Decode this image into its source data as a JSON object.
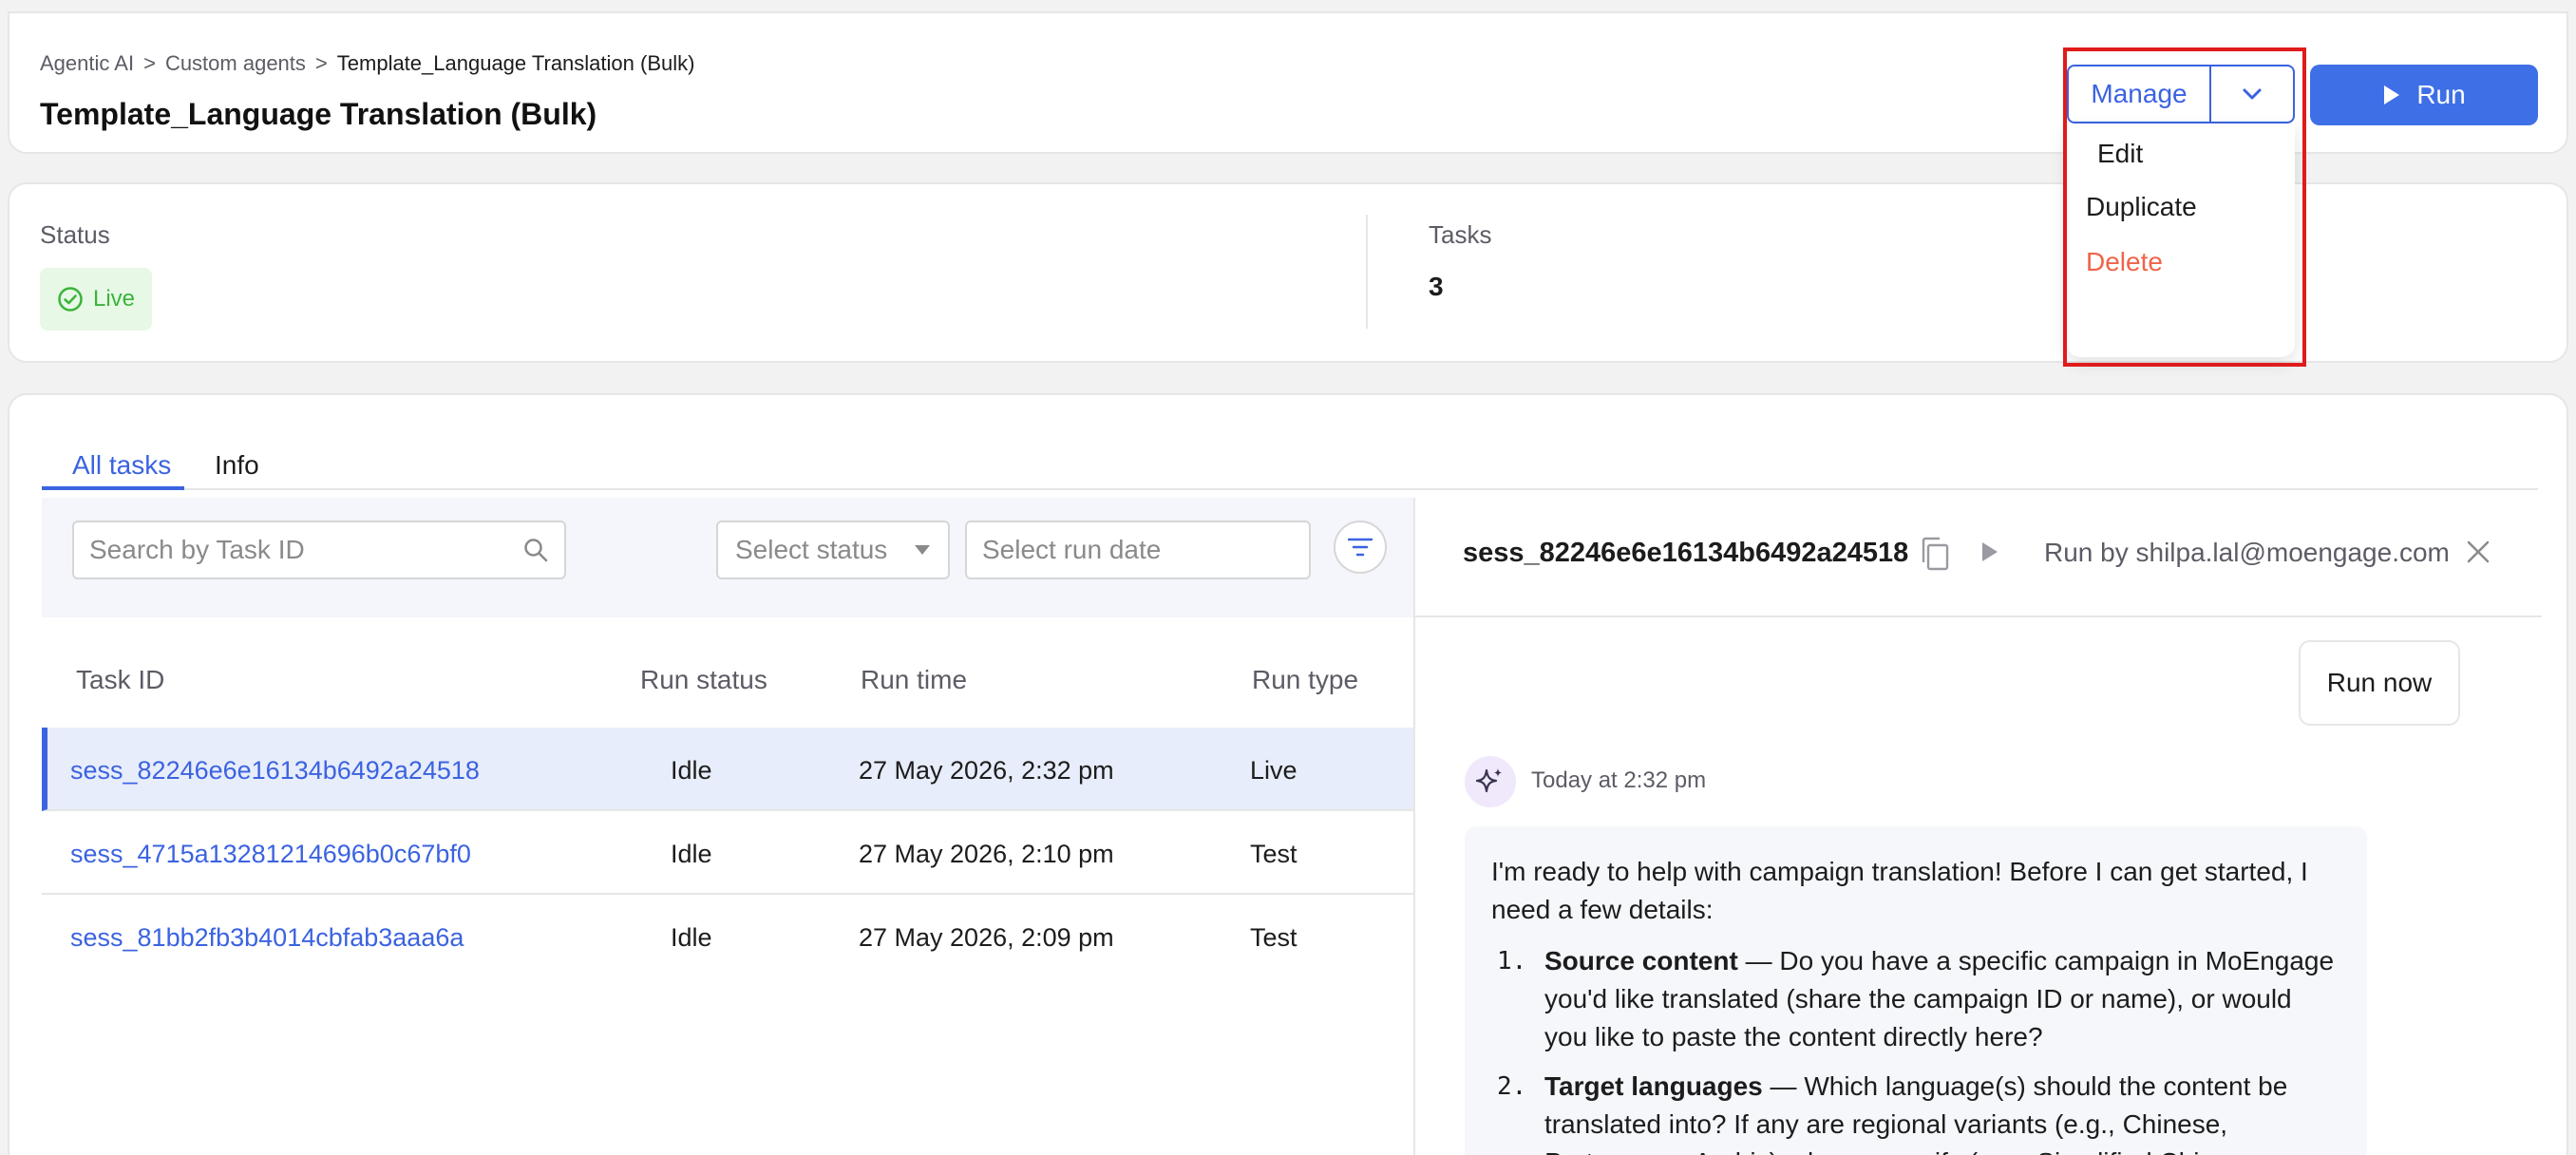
{
  "breadcrumb": [
    "Agentic AI",
    "Custom agents",
    "Template_Language Translation (Bulk)"
  ],
  "page_title": "Template_Language Translation (Bulk)",
  "header": {
    "manage_label": "Manage",
    "run_label": "Run",
    "manage_menu": [
      "Edit",
      "Duplicate",
      "Delete"
    ]
  },
  "status_card": {
    "status_label": "Status",
    "status_value": "Live",
    "tasks_label": "Tasks",
    "tasks_value": "3"
  },
  "tabs": [
    "All tasks",
    "Info"
  ],
  "filters": {
    "search_placeholder": "Search by Task ID",
    "status_placeholder": "Select status",
    "date_placeholder": "Select run date"
  },
  "table": {
    "columns": [
      "Task ID",
      "Run status",
      "Run time",
      "Run type"
    ],
    "rows": [
      {
        "task_id": "sess_82246e6e16134b6492a24518",
        "status": "Idle",
        "time": "27 May 2026, 2:32 pm",
        "type": "Live"
      },
      {
        "task_id": "sess_4715a13281214696b0c67bf0",
        "status": "Idle",
        "time": "27 May 2026, 2:10 pm",
        "type": "Test"
      },
      {
        "task_id": "sess_81bb2fb3b4014cbfab3aaa6a",
        "status": "Idle",
        "time": "27 May 2026, 2:09 pm",
        "type": "Test"
      }
    ]
  },
  "session": {
    "id": "sess_82246e6e16134b6492a24518",
    "run_by": "Run by shilpa.lal@moengage.com",
    "run_now_label": "Run now",
    "message_time": "Today at 2:32 pm",
    "message_intro": "I'm ready to help with campaign translation! Before I can get started, I need a few details:",
    "message_items": [
      {
        "num": "1.",
        "title": "Source content",
        "text": " — Do you have a specific campaign in MoEngage you'd like translated (share the campaign ID or name), or would you like to paste the content directly here?"
      },
      {
        "num": "2.",
        "title": "Target languages",
        "text": " — Which language(s) should the content be translated into? If any are regional variants (e.g., Chinese, Portuguese, Arabic), please specify (e.g., Simplified Chinese"
      }
    ]
  },
  "colors": {
    "accent": "#3b63e0",
    "run_button": "#3e6fe6",
    "live_green": "#3ab43a",
    "danger": "#f0644a",
    "highlight_red": "#e01b1b"
  }
}
